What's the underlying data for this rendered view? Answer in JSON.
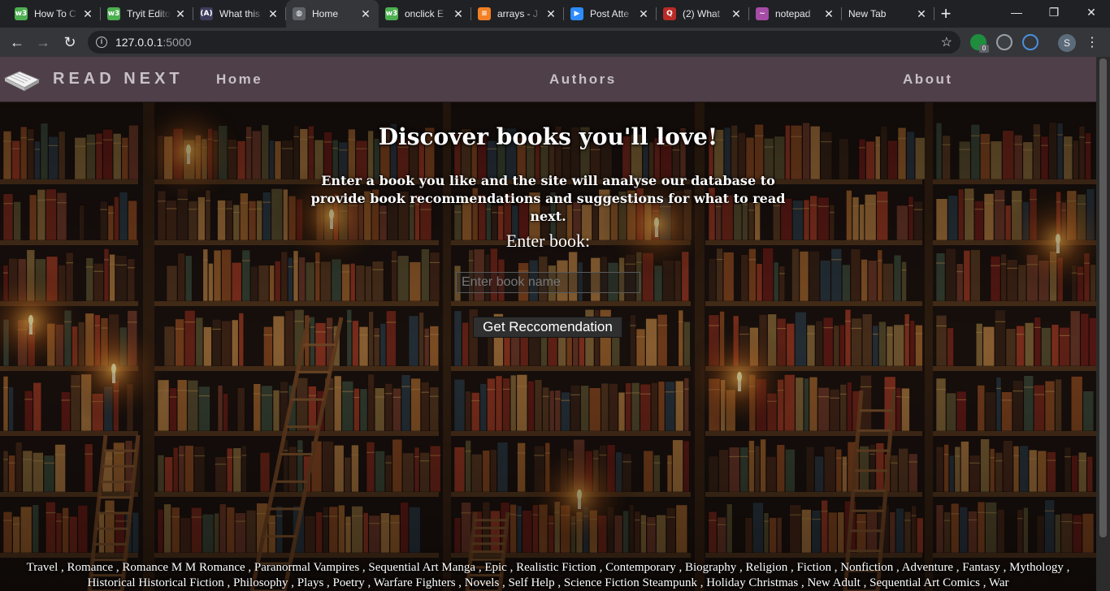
{
  "browser": {
    "tabs": [
      {
        "title": "How To C",
        "favicon": "w3-icon",
        "color": "#4caf50",
        "glyph": "w3"
      },
      {
        "title": "Tryit Edito",
        "favicon": "w3-icon",
        "color": "#4caf50",
        "glyph": "w3"
      },
      {
        "title": "What this",
        "favicon": "angular-icon",
        "color": "#3c3c5c",
        "glyph": "(A)"
      },
      {
        "title": "Home",
        "favicon": "globe-icon",
        "color": "#5f6368",
        "glyph": "◍",
        "active": true
      },
      {
        "title": "onclick E",
        "favicon": "w3-icon",
        "color": "#4caf50",
        "glyph": "w3"
      },
      {
        "title": "arrays - J",
        "favicon": "stackoverflow-icon",
        "color": "#f48024",
        "glyph": "≡"
      },
      {
        "title": "Post Atte",
        "favicon": "zoom-icon",
        "color": "#2d8cff",
        "glyph": "▶"
      },
      {
        "title": "(2) What",
        "favicon": "quora-icon",
        "color": "#b92b27",
        "glyph": "Q"
      },
      {
        "title": "notepad",
        "favicon": "notepad-icon",
        "color": "#a64ca6",
        "glyph": "~"
      },
      {
        "title": "New Tab",
        "favicon": "none",
        "color": "",
        "glyph": ""
      }
    ],
    "url_host": "127.0.0.1",
    "url_port": ":5000",
    "extension_badge": "0",
    "profile_initial": "S"
  },
  "site": {
    "brand": "READ NEXT",
    "nav": {
      "home": "Home",
      "authors": "Authors",
      "about": "About"
    },
    "headline": "Discover books you'll love!",
    "subline": "Enter a book you like and the site will analyse our database to provide book recommendations and suggestions for what to read next.",
    "enter_label": "Enter book:",
    "input_placeholder": "Enter book name",
    "button_label": "Get Reccomendation",
    "genres": [
      "Travel",
      "Romance",
      "Romance M M Romance",
      "Paranormal Vampires",
      "Sequential Art Manga",
      "Epic",
      "Realistic Fiction",
      "Contemporary",
      "Biography",
      "Religion",
      "Fiction",
      "Nonfiction",
      "Adventure",
      "Fantasy",
      "Mythology",
      "Historical Historical Fiction",
      "Philosophy",
      "Plays",
      "Poetry",
      "Warfare Fighters",
      "Novels",
      "Self Help",
      "Science Fiction Steampunk",
      "Holiday Christmas",
      "New Adult",
      "Sequential Art Comics",
      "War"
    ]
  },
  "colors": {
    "navbar": "#4e3f48",
    "navtext": "#c8c0c6"
  }
}
